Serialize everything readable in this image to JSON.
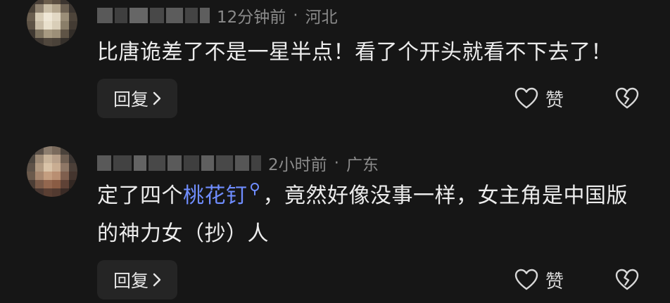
{
  "comments": [
    {
      "time": "12分钟前",
      "separator": "·",
      "location": "河北",
      "text": "比唐诡差了不是一星半点！看了个开头就看不下去了！",
      "reply_label": "回复",
      "like_label": "赞"
    },
    {
      "time": "2小时前",
      "separator": "·",
      "location": "广东",
      "text_before": "定了四个",
      "keyword": "桃花钉",
      "text_after": "，竟然好像没事一样，女主角是中国版的神力女（抄）人",
      "reply_label": "回复",
      "like_label": "赞"
    }
  ],
  "colors": {
    "background": "#161616",
    "keyword": "#6f8dff",
    "meta": "#8b8b8b",
    "button_bg": "#252525"
  },
  "icons": {
    "like": "heart-outline-icon",
    "dislike": "broken-heart-icon",
    "reply_arrow": "chevron-right-icon",
    "keyword_search": "search-icon"
  }
}
